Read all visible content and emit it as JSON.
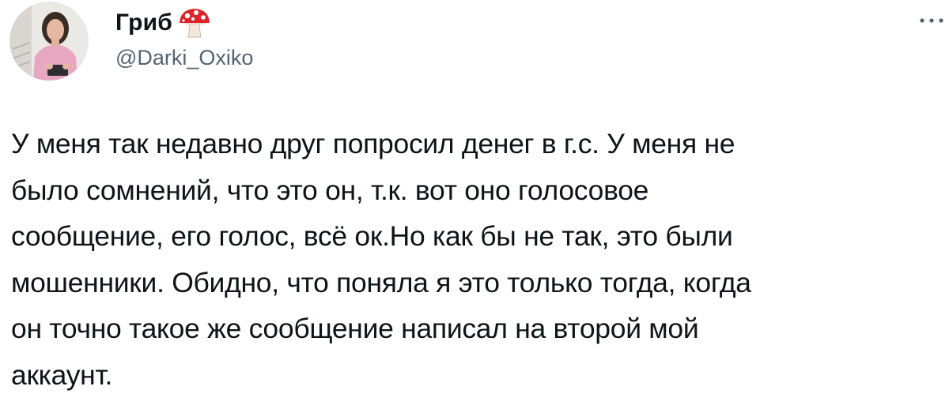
{
  "author": {
    "display_name": "Гриб",
    "handle": "@Darki_Oxiko",
    "name_emoji_icon": "mushroom-icon",
    "avatar_icon": "profile-photo"
  },
  "menu": {
    "more_icon": "more-horizontal-icon"
  },
  "tweet": {
    "text": "У меня так недавно друг попросил денег в г.с. У меня не\nбыло сомнений, что это он, т.к. вот оно голосовое\nсообщение, его голос, всё ок.Но как бы не так, это были\nмошенники. Обидно, что поняла я это только тогда, когда\nон точно такое же сообщение написал на второй мой\nаккаунт."
  },
  "colors": {
    "text_primary": "#0f1419",
    "text_secondary": "#536471",
    "mushroom_cap": "#d9262c",
    "background": "#ffffff"
  }
}
